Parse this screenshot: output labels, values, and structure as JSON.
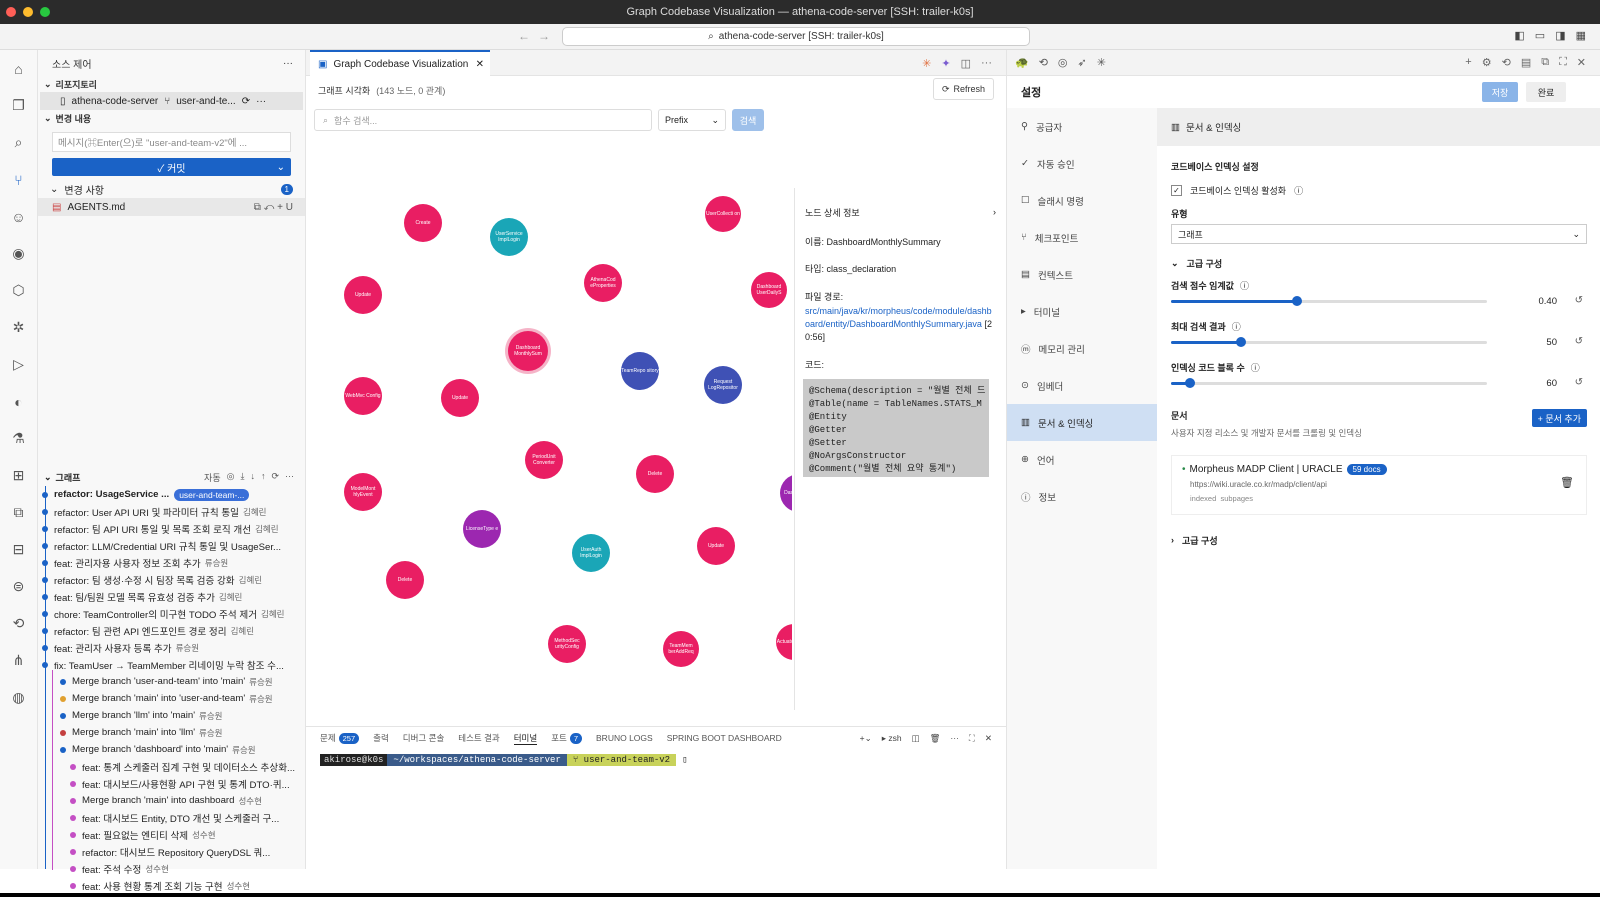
{
  "window": {
    "title": "Graph Codebase Visualization — athena-code-server [SSH: trailer-k0s]",
    "search": "athena-code-server [SSH: trailer-k0s]"
  },
  "sidebar": {
    "title": "소스 제어",
    "repo_section": "리포지토리",
    "repo_name": "athena-code-server",
    "repo_branch": "user-and-te...",
    "changes_section": "변경 내용",
    "message_placeholder": "메시지(⌘Enter(으)로 \"user-and-team-v2\"에 ...",
    "commit_label": "✓ 커밋",
    "changes_label": "변경 사항",
    "changes_count": "1",
    "file_name": "AGENTS.md",
    "file_status": "U",
    "graph_section": "그래프",
    "graph_auto": "자동"
  },
  "graph_items": [
    {
      "msg": "refactor: UsageService ...",
      "author": "",
      "branch": "user-and-team-...",
      "bold": true,
      "color": "#1a62c6"
    },
    {
      "msg": "refactor: User API URI 및 파라미터 규칙 통일",
      "author": "김혜린",
      "color": "#1a62c6"
    },
    {
      "msg": "refactor: 팀 API URI 통일 및 목록 조회 로직 개선",
      "author": "김혜린",
      "color": "#1a62c6"
    },
    {
      "msg": "refactor: LLM/Credential URI 규칙 통일 및 UsageSer...",
      "author": "",
      "color": "#1a62c6"
    },
    {
      "msg": "feat: 관리자용 사용자 정보 조회 추가",
      "author": "류승원",
      "color": "#1a62c6"
    },
    {
      "msg": "refactor: 팀 생성·수정 시 팀장 목록 검증 강화",
      "author": "김혜린",
      "color": "#1a62c6"
    },
    {
      "msg": "feat: 팀/팀원 모델 목록 유효성 검증 추가",
      "author": "김혜린",
      "color": "#1a62c6"
    },
    {
      "msg": "chore: TeamController의 미구현 TODO 주석 제거",
      "author": "김혜린",
      "color": "#1a62c6"
    },
    {
      "msg": "refactor: 팀 관련 API 엔드포인트 경로 정리",
      "author": "김혜린",
      "color": "#1a62c6"
    },
    {
      "msg": "feat: 관리자 사용자 등록 추가",
      "author": "류승원",
      "color": "#1a62c6"
    },
    {
      "msg": "fix: TeamUser → TeamMember 리네이밍 누락 참조 수...",
      "author": "",
      "color": "#1a62c6"
    },
    {
      "msg": "Merge branch 'user-and-team' into 'main'",
      "author": "류승원",
      "color": "#1a62c6"
    },
    {
      "msg": "Merge branch 'main' into 'user-and-team'",
      "author": "류승원",
      "color": "#e0a030"
    },
    {
      "msg": "Merge branch 'llm' into 'main'",
      "author": "류승원",
      "color": "#1a62c6"
    },
    {
      "msg": "Merge branch 'main' into 'llm'",
      "author": "류승원",
      "color": "#c44040"
    },
    {
      "msg": "Merge branch 'dashboard' into 'main'",
      "author": "류승원",
      "color": "#1a62c6"
    },
    {
      "msg": "feat: 통계 스케줄러 집계 구현 및 데이터소스 추상화...",
      "author": "",
      "color": "#c44fc4"
    },
    {
      "msg": "feat: 대시보드/사용현황 API 구현 및 통계 DTO·퀴...",
      "author": "",
      "color": "#c44fc4"
    },
    {
      "msg": "Merge branch 'main' into dashboard",
      "author": "성수현",
      "color": "#c44fc4"
    },
    {
      "msg": "feat: 대시보드 Entity, DTO 개선 및 스케줄러 구...",
      "author": "",
      "color": "#c44fc4"
    },
    {
      "msg": "feat: 필요없는 엔티티 삭제",
      "author": "성수현",
      "color": "#c44fc4"
    },
    {
      "msg": "refactor: 대시보드 Repository QueryDSL 쿼...",
      "author": "",
      "color": "#c44fc4"
    },
    {
      "msg": "feat: 주석 수정",
      "author": "성수현",
      "color": "#c44fc4"
    },
    {
      "msg": "feat: 사용 현황 통계 조회 기능 구현",
      "author": "성수현",
      "color": "#c44fc4"
    }
  ],
  "editor": {
    "tab": "Graph Codebase Visualization",
    "graph_label": "그래프 시각화",
    "graph_meta": "(143 노드, 0 관계)",
    "refresh": "Refresh",
    "search_placeholder": "함수 검색...",
    "prefix": "Prefix",
    "search_btn": "검색"
  },
  "nodes": [
    {
      "label": "Create",
      "color": "#e91e63"
    },
    {
      "label": "UserService ImplLogin",
      "color": "#1aa6b7"
    },
    {
      "label": "UserCollecti on",
      "color": "#e91e63"
    },
    {
      "label": "Update",
      "color": "#e91e63"
    },
    {
      "label": "AthenaCod eProperties",
      "color": "#e91e63"
    },
    {
      "label": "Dashboard UserDailyS",
      "color": "#e91e63"
    },
    {
      "label": "Dashboard MonthlySum",
      "color": "#e91e63"
    },
    {
      "label": "TeamRepo sitory",
      "color": "#3f51b5"
    },
    {
      "label": "Request LogRepositor",
      "color": "#3f51b5"
    },
    {
      "label": "WebMvc Config",
      "color": "#e91e63"
    },
    {
      "label": "Update",
      "color": "#e91e63"
    },
    {
      "label": "PeriodUnit Converter",
      "color": "#e91e63"
    },
    {
      "label": "Delete",
      "color": "#e91e63"
    },
    {
      "label": "ModelMont hlyEvent",
      "color": "#e91e63"
    },
    {
      "label": "LicenseType e",
      "color": "#9c27b0"
    },
    {
      "label": "Dashb Month",
      "color": "#9c27b0"
    },
    {
      "label": "UserAuth ImplLogin",
      "color": "#1aa6b7"
    },
    {
      "label": "Update",
      "color": "#e91e63"
    },
    {
      "label": "Delete",
      "color": "#e91e63"
    },
    {
      "label": "MethodSec urityConfig",
      "color": "#e91e63"
    },
    {
      "label": "TeamMem berAddReq",
      "color": "#e91e63"
    },
    {
      "label": "Actuator Config",
      "color": "#e91e63"
    }
  ],
  "detail": {
    "title": "노드 상세 정보",
    "name": "이름: DashboardMonthlySummary",
    "type": "타입: class_declaration",
    "path_label": "파일 경로:",
    "path": "src/main/java/kr/morpheus/code/module/dashboard/entity/DashboardMonthlySummary.java",
    "lines": "[20:56]",
    "code_label": "코드:",
    "code": "@Schema(description = \"월별 전체 드\n@Table(name = TableNames.STATS_M\n@Entity\n@Getter\n@Setter\n@NoArgsConstructor\n@Comment(\"월별 전체 요약 통계\")"
  },
  "panel": {
    "tabs": [
      "문제",
      "출력",
      "디버그 콘솔",
      "테스트 결과",
      "터미널",
      "포트",
      "BRUNO LOGS",
      "SPRING BOOT DASHBOARD"
    ],
    "problems": "257",
    "ports": "7",
    "shell": "zsh",
    "term_user": "akirose@k0s",
    "term_path": "~/workspaces/athena-code-server",
    "term_branch": "user-and-team-v2"
  },
  "settings": {
    "title": "설정",
    "save": "저장",
    "done": "완료",
    "nav": [
      "공급자",
      "자동 승인",
      "슬래시 명령",
      "체크포인트",
      "컨텍스트",
      "터미널",
      "메모리 관리",
      "임베더",
      "문서 & 인덱싱",
      "언어",
      "정보"
    ],
    "section": "문서 & 인덱싱",
    "indexing_title": "코드베이스 인덱싱 설정",
    "enable": "코드베이스 인덱싱 활성화",
    "type_label": "유형",
    "type_value": "그래프",
    "advanced": "고급 구성",
    "threshold_label": "검색 점수 임계값",
    "threshold": "0.40",
    "threshold_frac": 0.4,
    "max_label": "최대 검색 결과",
    "max": "50",
    "max_frac": 0.22,
    "blocks_label": "인덱싱 코드 블록 수",
    "blocks": "60",
    "blocks_frac": 0.06,
    "docs_label": "문서",
    "docs_desc": "사용자 지정 리소스 및 개발자 문서를 크롤링 및 인덱싱",
    "add_doc": "+ 문서 추가",
    "doc_title": "Morpheus MADP Client | URACLE",
    "doc_count": "59 docs",
    "doc_url": "https://wiki.uracle.co.kr/madp/client/api",
    "doc_meta1": "indexed",
    "doc_meta2": "subpages",
    "advanced2": "고급 구성"
  }
}
